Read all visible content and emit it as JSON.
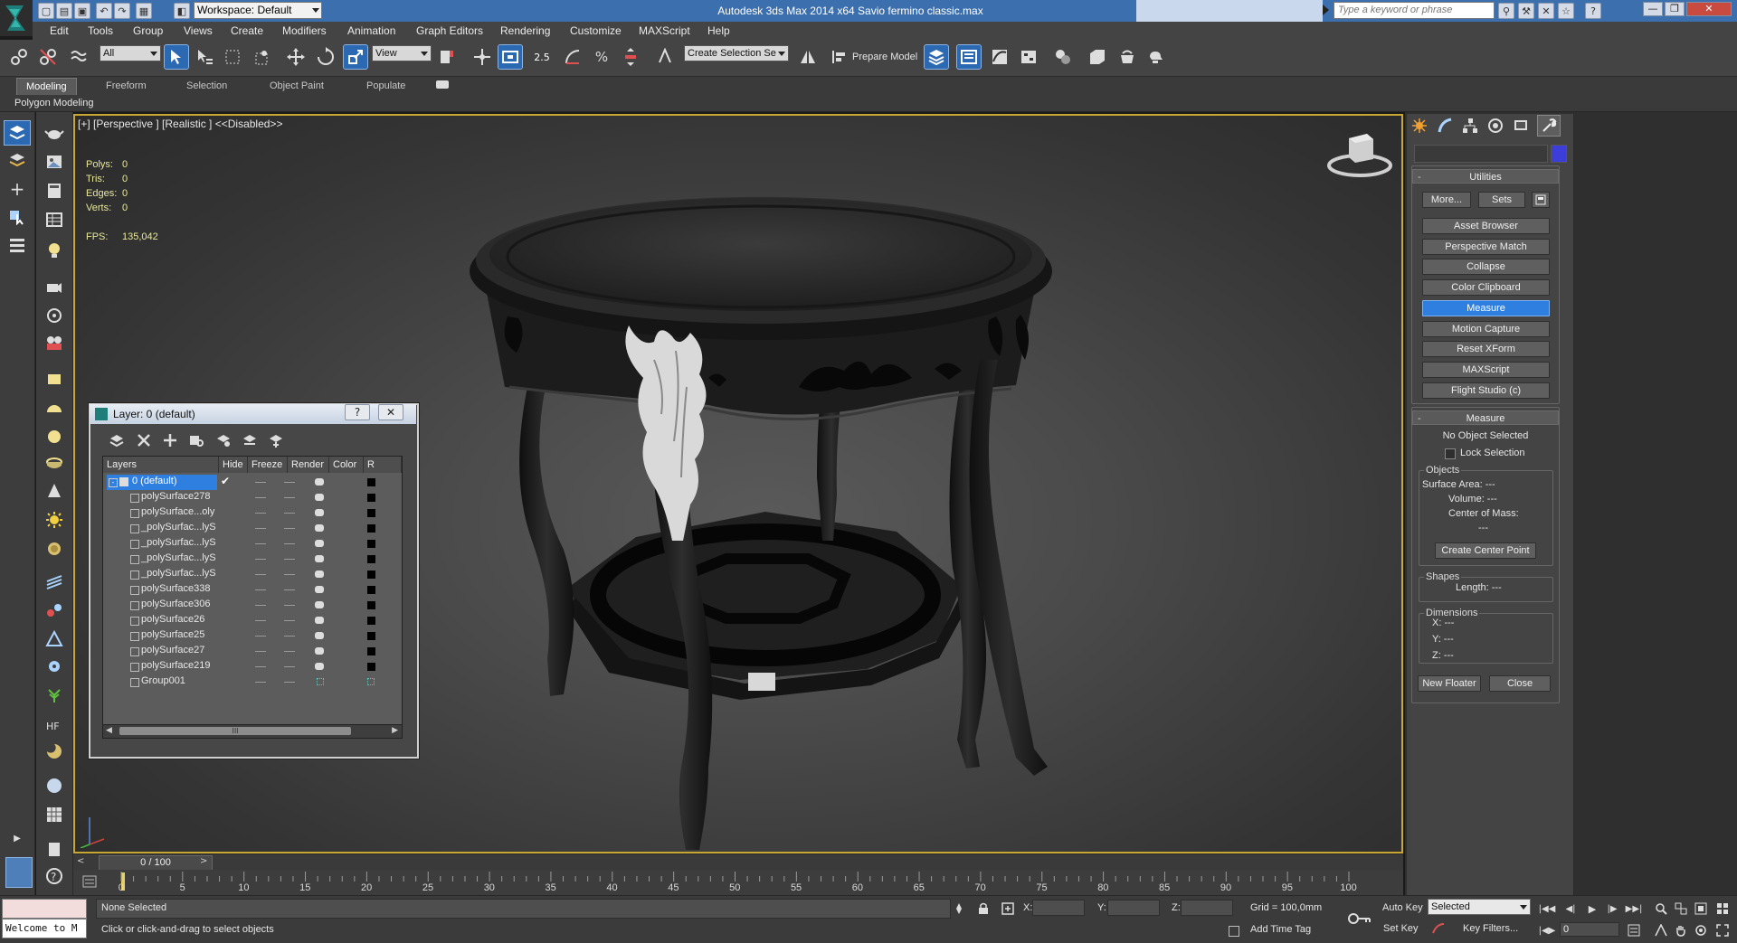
{
  "app": {
    "title": "Autodesk 3ds Max  2014 x64     Savio fermino classic.max",
    "workspace": "Workspace: Default",
    "search_placeholder": "Type a keyword or phrase"
  },
  "menu": [
    "Edit",
    "Tools",
    "Group",
    "Views",
    "Create",
    "Modifiers",
    "Animation",
    "Graph Editors",
    "Rendering",
    "Customize",
    "MAXScript",
    "Help"
  ],
  "toolbar": {
    "selection_filter": "All",
    "ref_coord": "View",
    "snap_angle": "2.5",
    "named_selection": "Create Selection Se",
    "prepare_model": "Prepare Model"
  },
  "ribbon": {
    "tabs": [
      "Modeling",
      "Freeform",
      "Selection",
      "Object Paint",
      "Populate"
    ],
    "active_tab": "Modeling",
    "sub_label": "Polygon Modeling"
  },
  "viewport": {
    "label": "[+] [Perspective ] [Realistic ]  <<Disabled>>",
    "stats": [
      {
        "label": "Polys:",
        "value": "0"
      },
      {
        "label": "Tris:",
        "value": "0"
      },
      {
        "label": "Edges:",
        "value": "0"
      },
      {
        "label": "Verts:",
        "value": "0"
      }
    ],
    "fps_label": "FPS:",
    "fps_value": "135,042"
  },
  "layer_dialog": {
    "title": "Layer: 0 (default)",
    "help": "?",
    "close": "✕",
    "columns": [
      "Layers",
      "Hide",
      "Freeze",
      "Render",
      "Color",
      "R"
    ],
    "default_layer": "0 (default)",
    "rows": [
      "polySurface278",
      "polySurface...oly",
      "_polySurfac...lyS",
      "_polySurfac...lyS",
      "_polySurfac...lyS",
      "_polySurfac...lyS",
      "polySurface338",
      "polySurface306",
      "polySurface26",
      "polySurface25",
      "polySurface27",
      "polySurface219",
      "Group001"
    ],
    "scroll_thumb_label": "III"
  },
  "command_panel": {
    "utilities_title": "Utilities",
    "more_btn": "More...",
    "sets_btn": "Sets",
    "utility_buttons": [
      "Asset Browser",
      "Perspective Match",
      "Collapse",
      "Color Clipboard",
      "Measure",
      "Motion Capture",
      "Reset XForm",
      "MAXScript",
      "Flight Studio (c)"
    ],
    "active_utility": "Measure",
    "measure_title": "Measure",
    "no_object": "No Object Selected",
    "lock_selection": "Lock Selection",
    "objects_group": "Objects",
    "surface_area": "Surface Area:  ---",
    "volume": "Volume:  ---",
    "center_of_mass": "Center of Mass:",
    "center_value": "---",
    "create_center_point": "Create Center Point",
    "shapes_group": "Shapes",
    "length": "Length:  ---",
    "dimensions_group": "Dimensions",
    "dim_x": "X:   ---",
    "dim_y": "Y:   ---",
    "dim_z": "Z:   ---",
    "new_floater": "New Floater",
    "close": "Close"
  },
  "timeline": {
    "frame_display": "0 / 100",
    "ticks": [
      "0",
      "5",
      "10",
      "15",
      "20",
      "25",
      "30",
      "35",
      "40",
      "45",
      "50",
      "55",
      "60",
      "65",
      "70",
      "75",
      "80",
      "85",
      "90",
      "95",
      "100"
    ]
  },
  "status": {
    "maxscript_welcome": "Welcome to M",
    "selection": "None Selected",
    "prompt": "Click or click-and-drag to select objects",
    "x_label": "X:",
    "y_label": "Y:",
    "z_label": "Z:",
    "grid": "Grid = 100,0mm",
    "add_time_tag": "Add Time Tag",
    "auto_key": "Auto Key",
    "set_key": "Set Key",
    "key_mode": "Selected",
    "key_filters": "Key Filters...",
    "current_frame": "0"
  },
  "colors": {
    "title_blue": "#3b6fae",
    "viewport_border": "#c8a832",
    "active_button": "#2f7fe0",
    "stats_yellow": "#e8e89a"
  }
}
